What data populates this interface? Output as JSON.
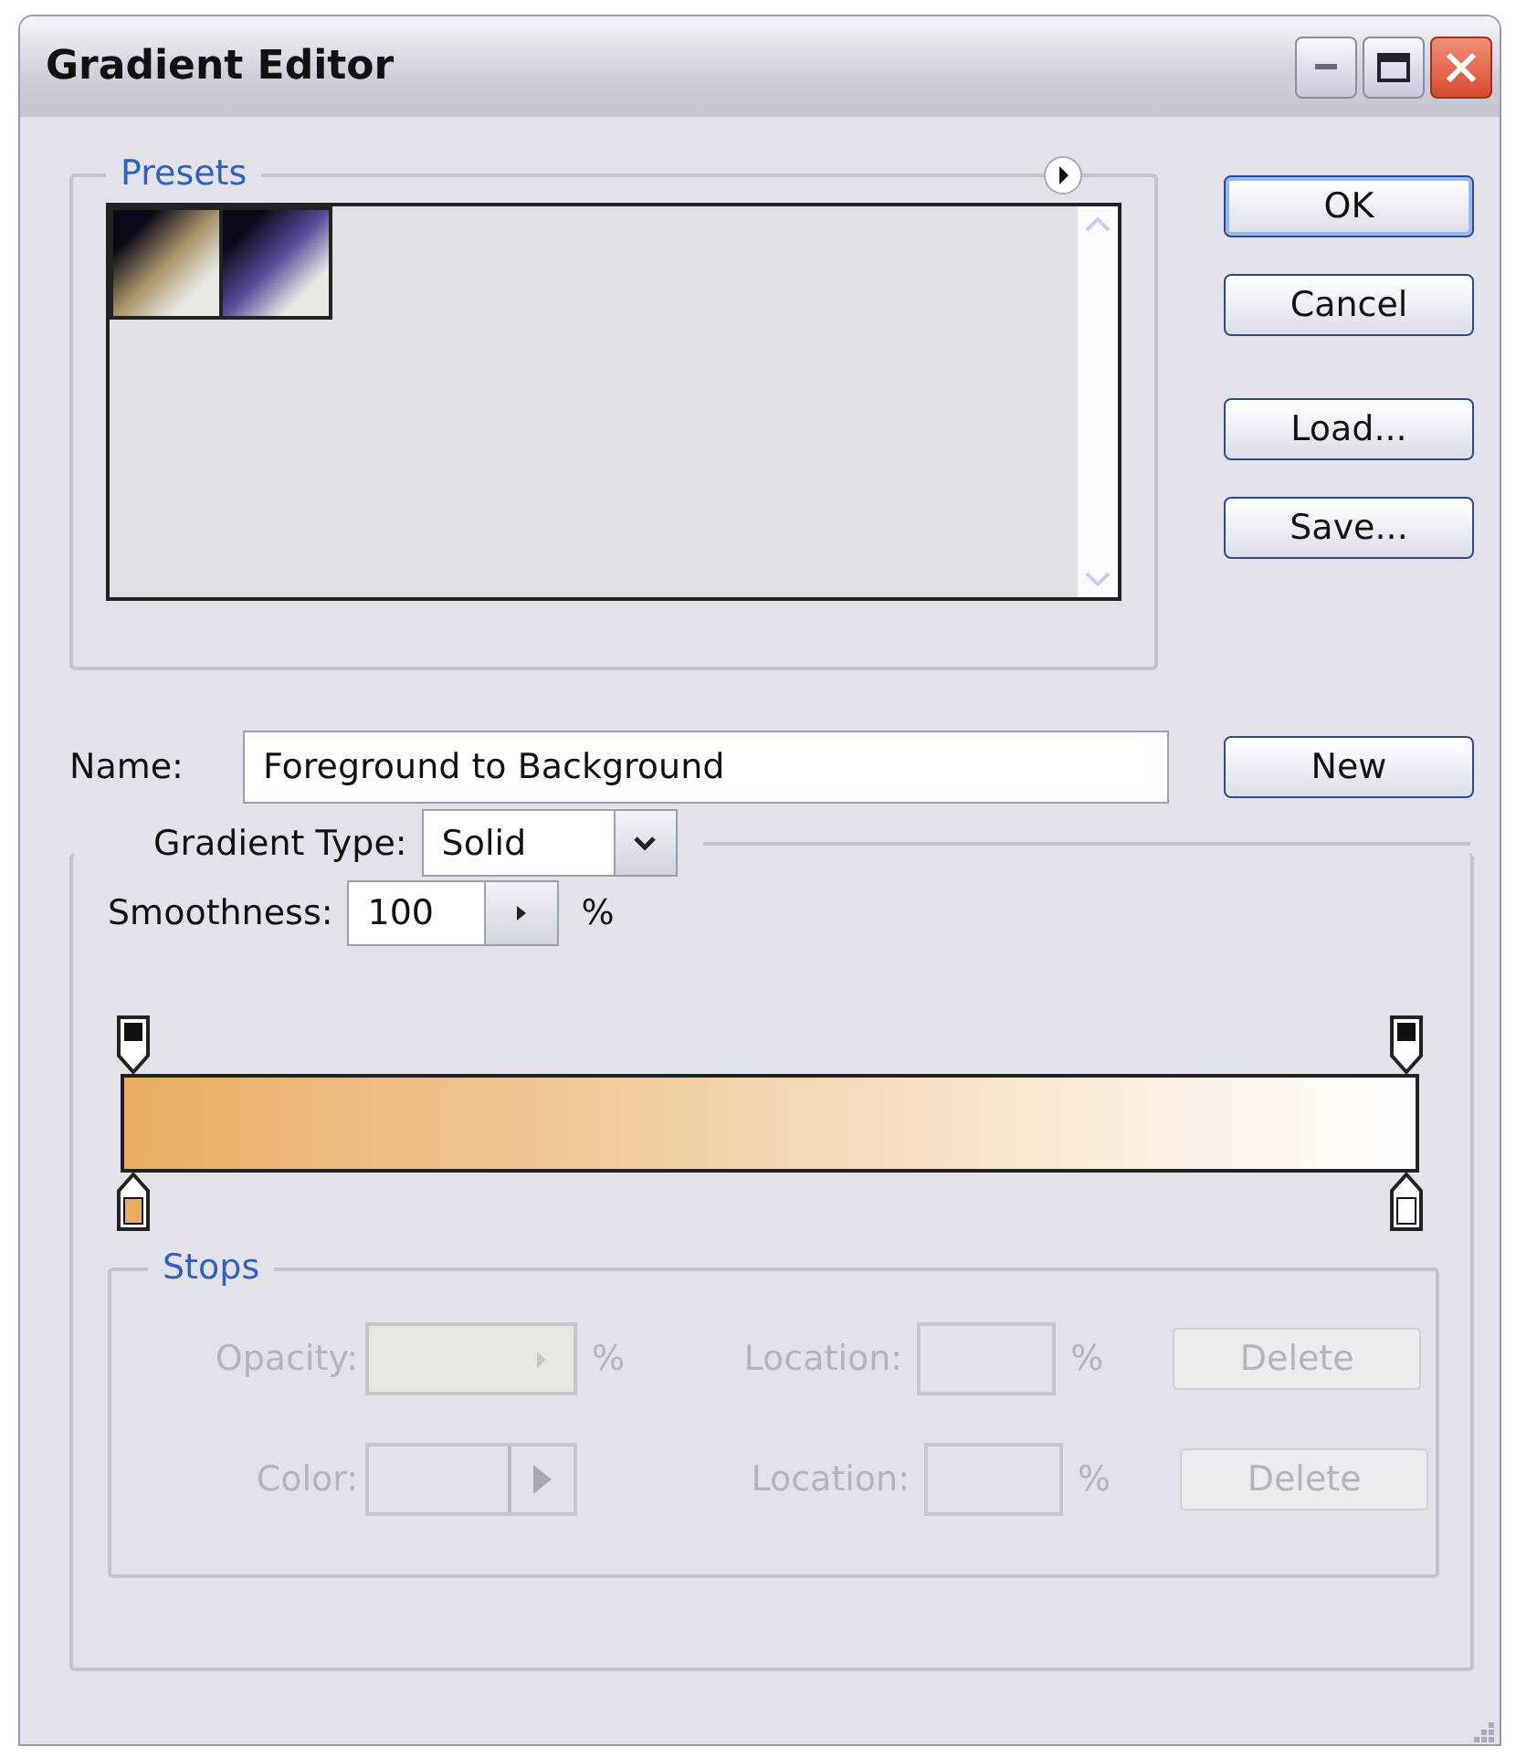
{
  "window": {
    "title": "Gradient Editor"
  },
  "presets": {
    "label": "Presets",
    "items": [
      {
        "color": "#a8946a"
      },
      {
        "color": "#5a4c9c"
      }
    ]
  },
  "buttons": [
    {
      "label": "OK",
      "default": true
    },
    {
      "label": "Cancel",
      "default": false
    },
    {
      "label": "Load...",
      "default": false
    },
    {
      "label": "Save..."
    }
  ],
  "name": {
    "label": "Name:",
    "value": "Foreground to Background",
    "button": "New"
  },
  "gradient": {
    "type_label": "Gradient Type:",
    "type_value": "Solid",
    "smoothness_label": "Smoothness:",
    "smoothness_value": "100",
    "smoothness_unit": "%",
    "color_stops": [
      {
        "color": "#e8ac62"
      },
      {
        "color": "#ffffff"
      }
    ]
  },
  "stops": {
    "label": "Stops",
    "disabled": true,
    "rows": [
      {
        "kind": "opacity",
        "label": "Opacity:",
        "unit": "%",
        "location_label": "Location:",
        "location_unit": "%",
        "button": "Delete"
      },
      {
        "kind": "color",
        "label": "Color:",
        "location_label": "Location:",
        "location_unit": "%",
        "button": "Delete"
      }
    ]
  }
}
